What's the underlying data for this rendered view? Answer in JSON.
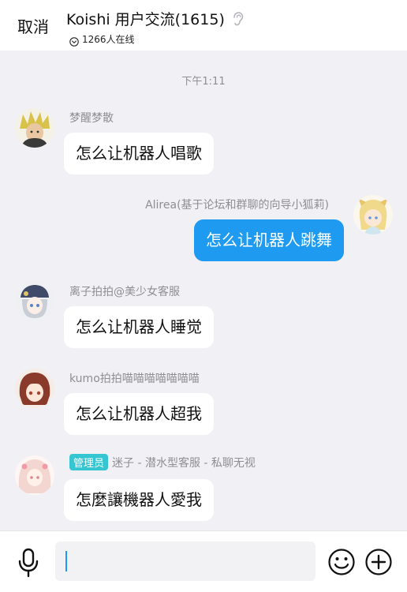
{
  "header": {
    "cancel_label": "取消",
    "title": "Koishi 用户交流(1615)",
    "online_count": "1266人在线"
  },
  "timestamp": "下午1:11",
  "messages": [
    {
      "sender": "梦醒梦散",
      "text": "怎么让机器人唱歌",
      "self": false
    },
    {
      "sender": "Alirea(基于论坛和群聊的向导小狐莉)",
      "text": "怎么让机器人跳舞",
      "self": true
    },
    {
      "sender": "离子拍拍@美少女客服",
      "text": "怎么让机器人睡觉",
      "self": false
    },
    {
      "sender": "kumo拍拍喵喵喵喵喵喵喵",
      "text": "怎么让机器人超我",
      "self": false
    },
    {
      "badge": "管理员",
      "sender": "迷子 - 潜水型客服 - 私聊无视",
      "text": "怎麼讓機器人愛我",
      "self": false
    }
  ],
  "input": {
    "value": "",
    "placeholder": ""
  },
  "colors": {
    "self_bubble": "#1e9bf0",
    "admin_badge": "#35c6d2",
    "background": "#f1f0f5"
  },
  "icons": [
    "ear-icon",
    "chevron-circle-icon",
    "microphone-icon",
    "emoji-icon",
    "plus-circle-icon"
  ]
}
